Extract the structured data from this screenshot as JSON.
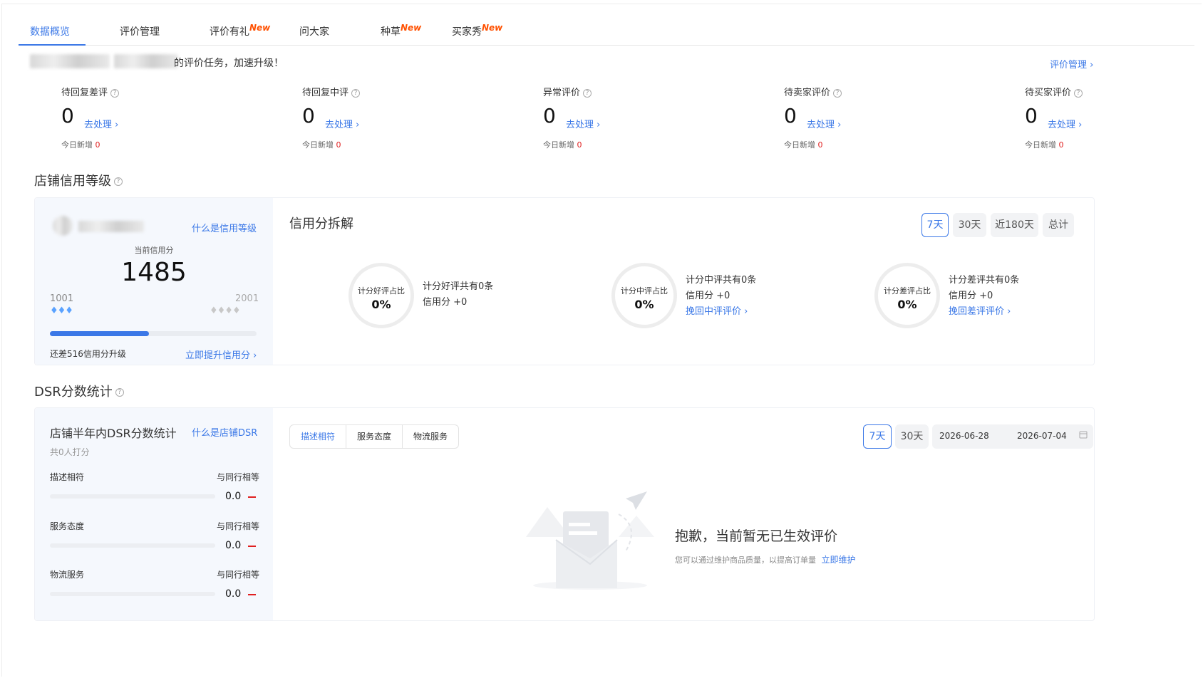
{
  "tabs": [
    {
      "label": "数据概览",
      "badge": ""
    },
    {
      "label": "评价管理",
      "badge": ""
    },
    {
      "label": "评价有礼",
      "badge": "New"
    },
    {
      "label": "问大家",
      "badge": ""
    },
    {
      "label": "种草",
      "badge": "New"
    },
    {
      "label": "买家秀",
      "badge": "New"
    }
  ],
  "notice": {
    "text": "的评价任务，加速升级！",
    "manage_link": "评价管理 ›"
  },
  "metrics": [
    {
      "title": "待回复差评",
      "value": "0",
      "action": "去处理 ›",
      "today_label": "今日新增",
      "today_value": "0"
    },
    {
      "title": "待回复中评",
      "value": "0",
      "action": "去处理 ›",
      "today_label": "今日新增",
      "today_value": "0"
    },
    {
      "title": "异常评价",
      "value": "0",
      "action": "去处理 ›",
      "today_label": "今日新增",
      "today_value": "0"
    },
    {
      "title": "待卖家评价",
      "value": "0",
      "action": "去处理 ›",
      "today_label": "今日新增",
      "today_value": "0"
    },
    {
      "title": "待买家评价",
      "value": "0",
      "action": "去处理 ›",
      "today_label": "今日新增",
      "today_value": "0"
    }
  ],
  "credit": {
    "section_title": "店铺信用等级",
    "what_link": "什么是信用等级",
    "current_label": "当前信用分",
    "score": "1485",
    "range_min": "1001",
    "range_max": "2001",
    "progress_fraction": 0.48,
    "gap_text": "还差516信用分升级",
    "upgrade_link": "立即提升信用分 ›"
  },
  "breakdown": {
    "title": "信用分拆解",
    "periods": [
      "7天",
      "30天",
      "近180天",
      "总计"
    ],
    "active_period": 0,
    "items": [
      {
        "circle_label": "计分好评占比",
        "percent": "0%",
        "line1": "计分好评共有0条",
        "line2": "信用分 +0",
        "link": ""
      },
      {
        "circle_label": "计分中评占比",
        "percent": "0%",
        "line1": "计分中评共有0条",
        "line2": "信用分 +0",
        "link": "挽回中评评价 ›"
      },
      {
        "circle_label": "计分差评占比",
        "percent": "0%",
        "line1": "计分差评共有0条",
        "line2": "信用分 +0",
        "link": "挽回差评评价 ›"
      }
    ]
  },
  "dsr": {
    "section_title": "DSR分数统计",
    "card_title": "店铺半年内DSR分数统计",
    "what_link": "什么是店铺DSR",
    "raters": "共0人打分",
    "rows": [
      {
        "label": "描述相符",
        "compare": "与同行相等",
        "value": "0.0"
      },
      {
        "label": "服务态度",
        "compare": "与同行相等",
        "value": "0.0"
      },
      {
        "label": "物流服务",
        "compare": "与同行相等",
        "value": "0.0"
      }
    ],
    "segments": [
      "描述相符",
      "服务态度",
      "物流服务"
    ],
    "periods": [
      "7天",
      "30天"
    ],
    "date_start": "2026-06-28",
    "date_end": "2026-07-04",
    "empty_title": "抱歉，当前暂无已生效评价",
    "empty_desc": "您可以通过维护商品质量，以提高订单量",
    "empty_link": "立即维护"
  },
  "colors": {
    "accent": "#3b78e7",
    "new_badge": "#ff5000",
    "negative": "#e02020"
  }
}
